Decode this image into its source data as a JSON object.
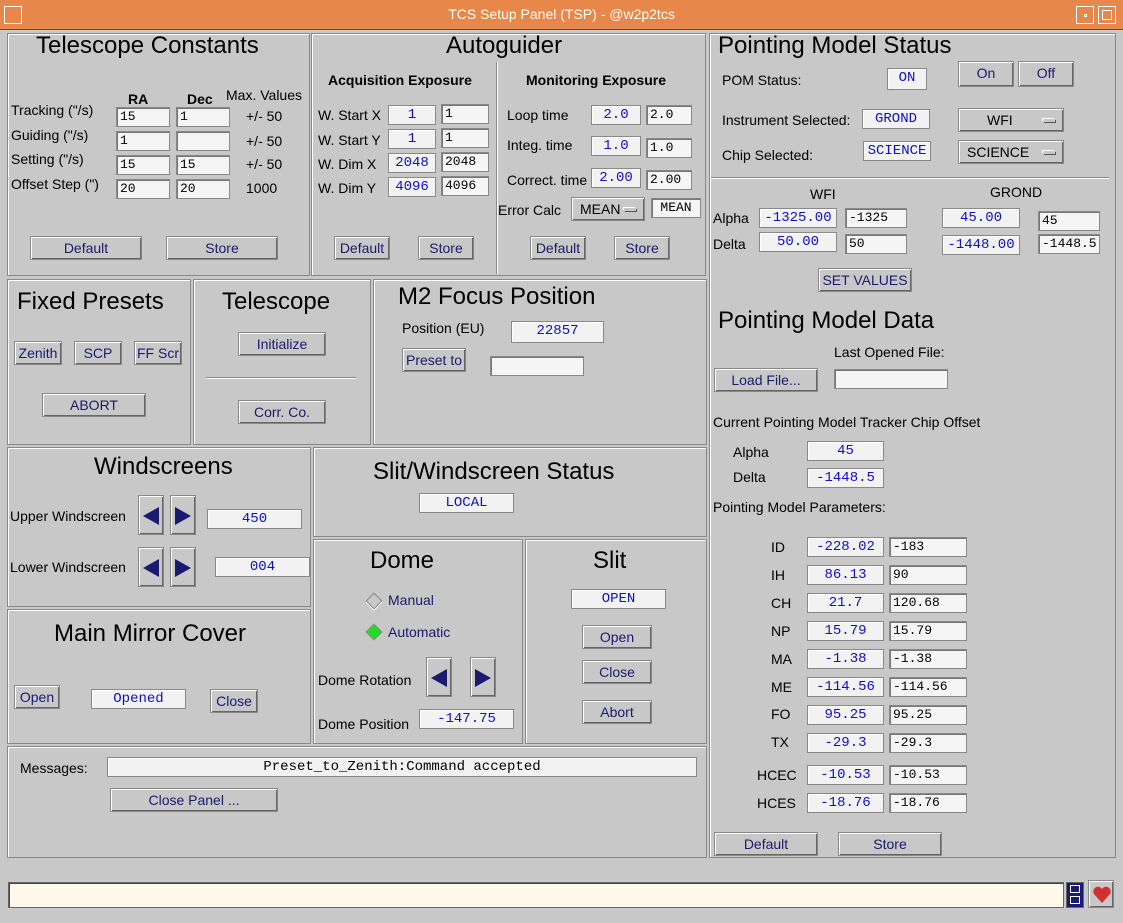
{
  "window": {
    "title": "TCS Setup Panel (TSP) - @w2p2tcs"
  },
  "telescope_constants": {
    "title": "Telescope Constants",
    "col_ra": "RA",
    "col_dec": "Dec",
    "col_max": "Max. Values",
    "rows": [
      {
        "label": "Tracking (\"/s)",
        "ra": "15",
        "dec": "1",
        "max": "+/- 50"
      },
      {
        "label": "Guiding (\"/s)",
        "ra": "1",
        "dec": "",
        "max": "+/- 50"
      },
      {
        "label": "Setting (\"/s)",
        "ra": "15",
        "dec": "15",
        "max": "+/- 50"
      },
      {
        "label": "Offset Step (\")",
        "ra": "20",
        "dec": "20",
        "max": "1000"
      }
    ],
    "default_label": "Default",
    "store_label": "Store"
  },
  "autoguider": {
    "title": "Autoguider",
    "acq": {
      "title": "Acquisition Exposure",
      "rows": [
        {
          "label": "W. Start X",
          "value": "1",
          "input": "1"
        },
        {
          "label": "W. Start Y",
          "value": "1",
          "input": "1"
        },
        {
          "label": "W. Dim X",
          "value": "2048",
          "input": "2048"
        },
        {
          "label": "W. Dim Y",
          "value": "4096",
          "input": "4096"
        }
      ],
      "default_label": "Default",
      "store_label": "Store"
    },
    "mon": {
      "title": "Monitoring Exposure",
      "rows": [
        {
          "label": "Loop time",
          "value": "2.0",
          "input": "2.0"
        },
        {
          "label": "Integ. time",
          "value": "1.0",
          "input": "1.0"
        },
        {
          "label": "Correct. time",
          "value": "2.00",
          "input": "2.00"
        }
      ],
      "error_calc_label": "Error Calc",
      "error_calc_option": "MEAN",
      "error_calc_value": "MEAN",
      "default_label": "Default",
      "store_label": "Store"
    }
  },
  "fixed_presets": {
    "title": "Fixed Presets",
    "zenith": "Zenith",
    "scp": "SCP",
    "ffscr": "FF Scr",
    "abort": "ABORT"
  },
  "telescope": {
    "title": "Telescope",
    "initialize": "Initialize",
    "corr_co": "Corr. Co."
  },
  "m2_focus": {
    "title": "M2 Focus Position",
    "position_label": "Position (EU)",
    "position_value": "22857",
    "preset_label": "Preset to",
    "preset_input": ""
  },
  "windscreens": {
    "title": "Windscreens",
    "upper_label": "Upper Windscreen",
    "upper_value": "450",
    "lower_label": "Lower Windscreen",
    "lower_value": "004"
  },
  "slit_ws_status": {
    "title": "Slit/Windscreen Status",
    "value": "LOCAL"
  },
  "main_mirror": {
    "title": "Main Mirror Cover",
    "open": "Open",
    "status": "Opened",
    "close": "Close"
  },
  "dome": {
    "title": "Dome",
    "manual": "Manual",
    "automatic": "Automatic",
    "rotation_label": "Dome Rotation",
    "position_label": "Dome Position",
    "position_value": "-147.75"
  },
  "slit": {
    "title": "Slit",
    "status": "OPEN",
    "open": "Open",
    "close": "Close",
    "abort": "Abort"
  },
  "messages": {
    "label": "Messages:",
    "text": "Preset_to_Zenith:Command accepted",
    "close_panel": "Close Panel ..."
  },
  "pom_status": {
    "title": "Pointing Model Status",
    "status_label": "POM Status:",
    "status_value": "ON",
    "on": "On",
    "off": "Off",
    "instrument_label": "Instrument Selected:",
    "instrument_value": "GROND",
    "instrument_option": "WFI",
    "chip_label": "Chip Selected:",
    "chip_value": "SCIENCE",
    "chip_option": "SCIENCE",
    "wfi_header": "WFI",
    "grond_header": "GROND",
    "alpha_label": "Alpha",
    "delta_label": "Delta",
    "wfi_alpha": "-1325.00",
    "wfi_alpha_in": "-1325",
    "wfi_delta": "50.00",
    "wfi_delta_in": "50",
    "grond_alpha": "45.00",
    "grond_alpha_in": "45",
    "grond_delta": "-1448.00",
    "grond_delta_in": "-1448.5",
    "set_values": "SET VALUES"
  },
  "pom_data": {
    "title": "Pointing Model Data",
    "last_file_label": "Last Opened File:",
    "load_file": "Load File...",
    "last_file_value": "",
    "offset_title": "Current Pointing Model Tracker Chip Offset",
    "alpha_label": "Alpha",
    "alpha_value": "45",
    "delta_label": "Delta",
    "delta_value": "-1448.5",
    "params_title": "Pointing Model Parameters:",
    "params": [
      {
        "name": "ID",
        "value": "-228.02",
        "input": "-183"
      },
      {
        "name": "IH",
        "value": "86.13",
        "input": "90"
      },
      {
        "name": "CH",
        "value": "21.7",
        "input": "120.68"
      },
      {
        "name": "NP",
        "value": "15.79",
        "input": "15.79"
      },
      {
        "name": "MA",
        "value": "-1.38",
        "input": "-1.38"
      },
      {
        "name": "ME",
        "value": "-114.56",
        "input": "-114.56"
      },
      {
        "name": "FO",
        "value": "95.25",
        "input": "95.25"
      },
      {
        "name": "TX",
        "value": "-29.3",
        "input": "-29.3"
      },
      {
        "name": "HCEC",
        "value": "-10.53",
        "input": "-10.53"
      },
      {
        "name": "HCES",
        "value": "-18.76",
        "input": "-18.76"
      }
    ],
    "default_label": "Default",
    "store_label": "Store"
  },
  "statusbar": {
    "text": ""
  }
}
